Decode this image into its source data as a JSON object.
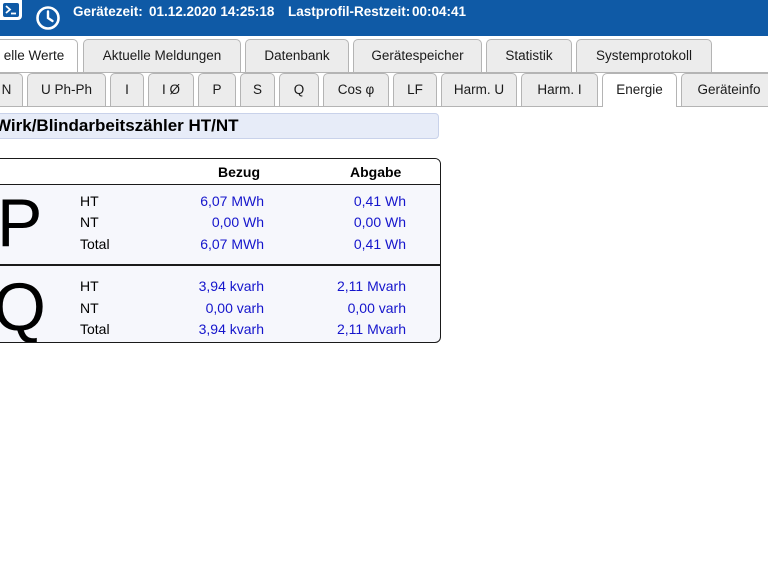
{
  "header": {
    "time_label": "Gerätezeit:",
    "time_value": "01.12.2020 14:25:18",
    "rest_label": "Lastprofil-Restzeit:",
    "rest_value": "00:04:41",
    "bg_color": "#0f5aa6"
  },
  "tabs_main": [
    {
      "label": "elle Werte",
      "active": true
    },
    {
      "label": "Aktuelle Meldungen"
    },
    {
      "label": "Datenbank"
    },
    {
      "label": "Gerätespeicher"
    },
    {
      "label": "Statistik"
    },
    {
      "label": "Systemprotokoll"
    }
  ],
  "tabs_sub": [
    {
      "label": "N"
    },
    {
      "label": "U Ph-Ph"
    },
    {
      "label": "I"
    },
    {
      "label": "I Ø"
    },
    {
      "label": "P"
    },
    {
      "label": "S"
    },
    {
      "label": "Q"
    },
    {
      "label": "Cos φ"
    },
    {
      "label": "LF"
    },
    {
      "label": "Harm. U"
    },
    {
      "label": "Harm. I"
    },
    {
      "label": "Energie",
      "active": true
    },
    {
      "label": "Geräteinfo"
    }
  ],
  "section": {
    "title": "Wirk/Blindarbeitszähler HT/NT"
  },
  "table": {
    "col_bezug": "Bezug",
    "col_abgabe": "Abgabe",
    "groups": [
      {
        "symbol": "P",
        "rows": [
          {
            "label": "HT",
            "bezug": "6,07 MWh",
            "abgabe": "0,41 Wh"
          },
          {
            "label": "NT",
            "bezug": "0,00 Wh",
            "abgabe": "0,00 Wh"
          },
          {
            "label": "Total",
            "bezug": "6,07 MWh",
            "abgabe": "0,41 Wh"
          }
        ]
      },
      {
        "symbol": "Q",
        "rows": [
          {
            "label": "HT",
            "bezug": "3,94 kvarh",
            "abgabe": "2,11 Mvarh"
          },
          {
            "label": "NT",
            "bezug": "0,00 varh",
            "abgabe": "0,00 varh"
          },
          {
            "label": "Total",
            "bezug": "3,94 kvarh",
            "abgabe": "2,11 Mvarh"
          }
        ]
      }
    ],
    "value_color": "#1515cc"
  }
}
